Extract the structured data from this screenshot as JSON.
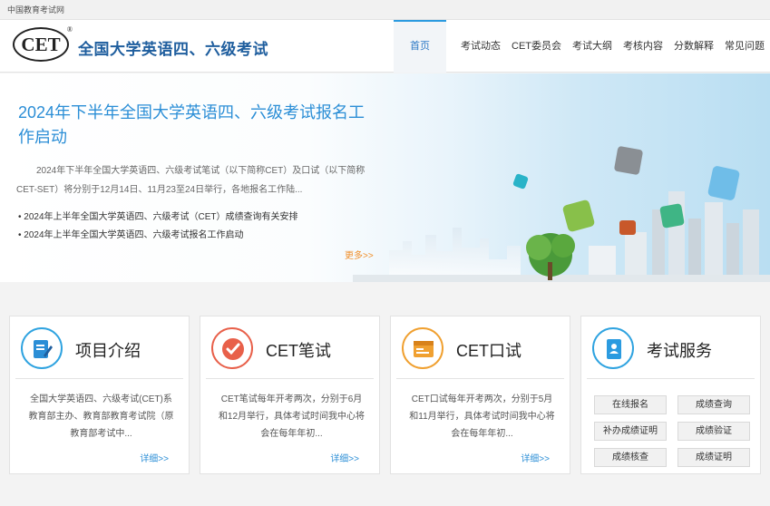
{
  "topbar": {
    "text": "中国教育考试网"
  },
  "header": {
    "logo_text": "CET",
    "registered": "®",
    "title": "全国大学英语四、六级考试"
  },
  "nav": [
    {
      "label": "首页",
      "active": true
    },
    {
      "label": "考试动态",
      "active": false
    },
    {
      "label": "CET委员会",
      "active": false
    },
    {
      "label": "考试大纲",
      "active": false
    },
    {
      "label": "考核内容",
      "active": false
    },
    {
      "label": "分数解释",
      "active": false
    },
    {
      "label": "常见问题",
      "active": false
    }
  ],
  "banner": {
    "headline": "2024年下半年全国大学英语四、六级考试报名工作启动",
    "summary": "2024年下半年全国大学英语四、六级考试笔试（以下简称CET）及口试（以下简称CET-SET）将分别于12月14日、11月23至24日举行，各地报名工作陆...",
    "news": [
      "2024年上半年全国大学英语四、六级考试（CET）成绩查询有关安排",
      "2024年上半年全国大学英语四、六级考试报名工作启动"
    ],
    "more": "更多>>"
  },
  "cards": [
    {
      "icon": "document-edit-icon",
      "title": "项目介绍",
      "desc": "全国大学英语四、六级考试(CET)系教育部主办、教育部教育考试院（原教育部考试中...",
      "detail": "详细>>"
    },
    {
      "icon": "checkmark-icon",
      "title": "CET笔试",
      "desc": "CET笔试每年开考两次，分别于6月和12月举行，具体考试时间我中心将会在每年年初...",
      "detail": "详细>>"
    },
    {
      "icon": "browser-window-icon",
      "title": "CET口试",
      "desc": "CET口试每年开考两次，分别于5月和11月举行，具体考试时间我中心将会在每年年初...",
      "detail": "详细>>"
    },
    {
      "icon": "contact-book-icon",
      "title": "考试服务",
      "buttons": [
        "在线报名",
        "成绩查询",
        "补办成绩证明",
        "成绩验证",
        "成绩核查",
        "成绩证明"
      ]
    }
  ],
  "colors": {
    "accent": "#2b8ed6",
    "more": "#f0902c",
    "title": "#1f5e9e"
  }
}
